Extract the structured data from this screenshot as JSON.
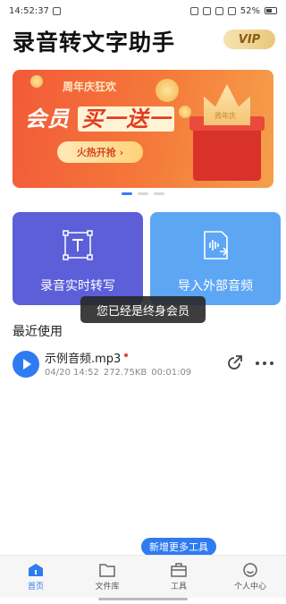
{
  "status_bar": {
    "time": "14:52:37",
    "battery": "52%"
  },
  "header": {
    "title": "录音转文字助手",
    "vip_label": "VIP"
  },
  "banner": {
    "subtitle": "周年庆狂欢",
    "headline_a": "会员",
    "headline_b": "买一送一",
    "button_label": "火热开抢",
    "crown_text": "周年庆",
    "slide_count": 3,
    "active_slide": 0
  },
  "actions": {
    "record_label": "录音实时转写",
    "import_label": "导入外部音频"
  },
  "recent": {
    "section_title": "最近使用",
    "files": [
      {
        "name": "示例音频.mp3",
        "date": "04/20 14:52",
        "size": "272.75KB",
        "duration": "00:01:09"
      }
    ]
  },
  "toast": "您已经是终身会员",
  "tooltip": "新增更多工具",
  "tabs": [
    {
      "label": "首页",
      "icon": "home-icon",
      "active": true
    },
    {
      "label": "文件库",
      "icon": "folder-icon",
      "active": false
    },
    {
      "label": "工具",
      "icon": "toolbox-icon",
      "active": false
    },
    {
      "label": "个人中心",
      "icon": "profile-icon",
      "active": false
    }
  ],
  "colors": {
    "accent": "#2f7bf2",
    "card_left": "#5c5fd8",
    "card_right": "#5ca6f4",
    "banner": "#f25a38"
  }
}
